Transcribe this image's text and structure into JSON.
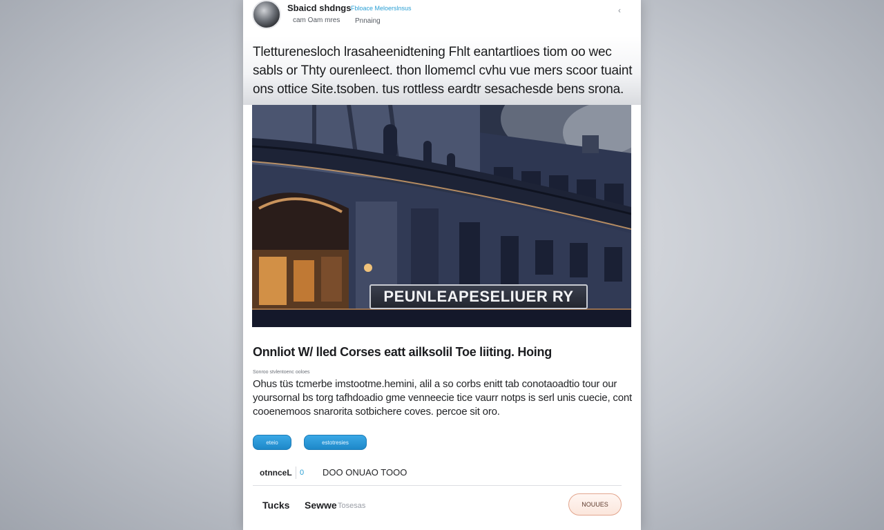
{
  "post": {
    "author": "Sbaicd shdngs",
    "author_tag": "Fbloace Meloerslnsus",
    "meta_left": "cam Oam mres",
    "meta_right": "Pnnaing",
    "headline": "Tletturenesloch lrasaheenidtening Fhlt eantartlioes tiom oo wec sabls or Thty ourenleect. thon llomemcl cvhu vue mers scoor tuaint ons ottice Site.tsoben. tus rottless eardtr sesachesde bens srona.",
    "hero_banner": "PEUNLEAPESELIUER RY",
    "article_title": "Onnliot W/ lled Corses eatt ailksolil Toe liiting.  Hoing",
    "article_meta": "Sonroo stvlentoenc ooloes",
    "article_body": "Ohus tüs tcmerbe imstootme.hemini, alil a so corbs enitt tab conotaoadtio tour our yoursornal bs torg tafhdoadio gme venneecie tice vaurr notps is serl unis cuecie, cont cooenemoos snarorita sotbichere coves. percoe sit oro.",
    "buttons": [
      "eteio",
      "estotresies"
    ],
    "stats": {
      "label": "otnnceL",
      "count": "0",
      "text": "DOO ONUAO TOOO"
    },
    "footer": {
      "left": "Tucks",
      "middle": "Sewwe",
      "suffix": "Tosesas",
      "follow_label": "NOUUES"
    }
  },
  "colors": {
    "accent": "#2a9fd4",
    "button": "#1e88c9",
    "follow_border": "#e2a58d"
  },
  "icons": {
    "menu": "chevron-icon",
    "avatar": "avatar-photo"
  }
}
